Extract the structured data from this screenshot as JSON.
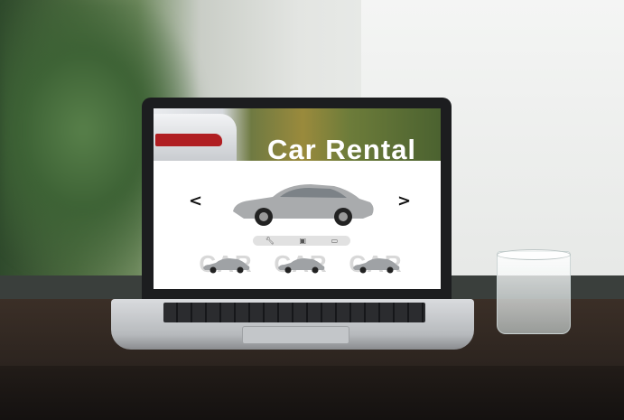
{
  "screen": {
    "hero_title": "Car Rental",
    "nav": {
      "prev_arrow": "<",
      "next_arrow": ">"
    },
    "icon_bar": [
      "wrench-icon",
      "seat-icon",
      "car-icon"
    ],
    "thumbnails": [
      {
        "word": "CAR"
      },
      {
        "word": "CAR"
      },
      {
        "word": "CAR"
      }
    ]
  },
  "colors": {
    "accent_red": "#b01e22",
    "wood": "#2c241f",
    "screen_bezel": "#1c1d1f"
  }
}
